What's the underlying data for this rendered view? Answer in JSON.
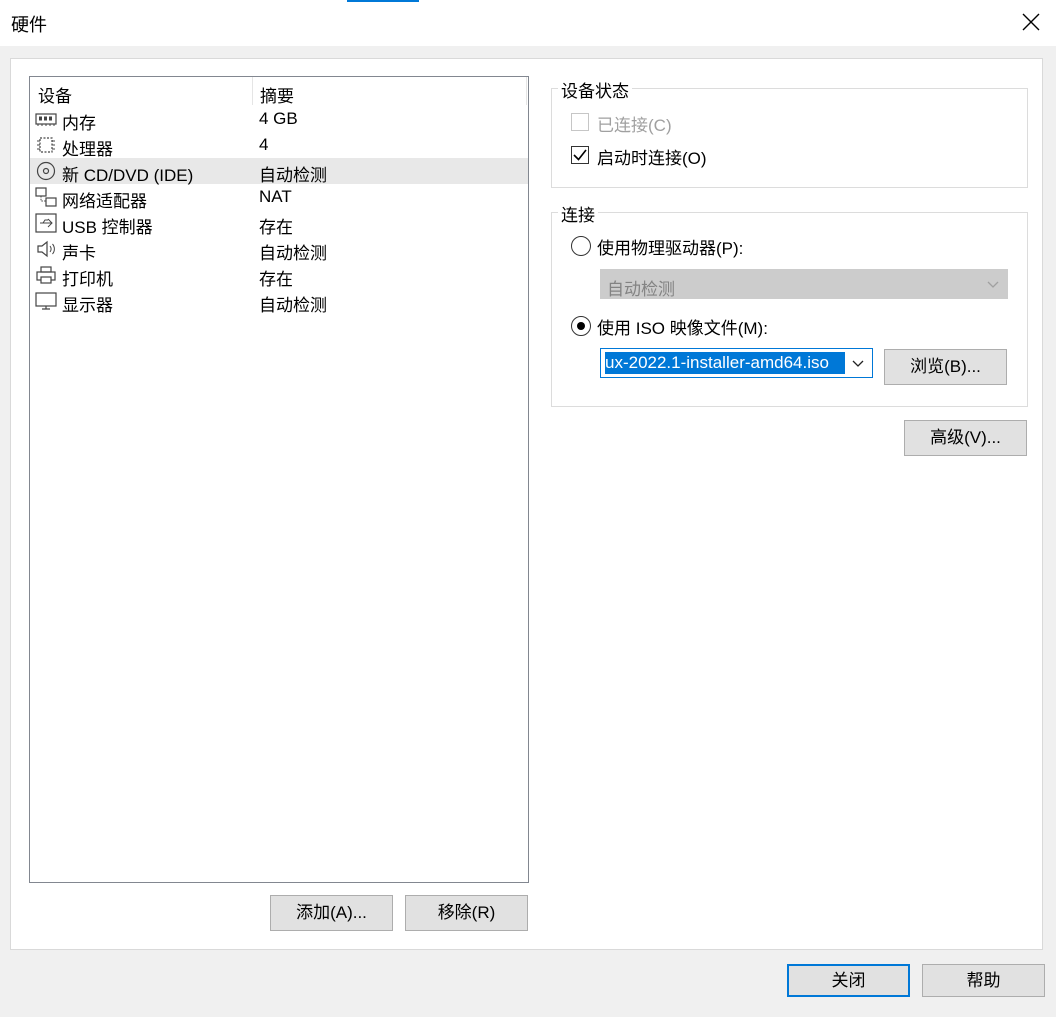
{
  "window": {
    "title": "硬件"
  },
  "device_list": {
    "columns": [
      "设备",
      "摘要"
    ],
    "rows": [
      {
        "icon": "memory-icon",
        "name": "内存",
        "summary": "4 GB",
        "selected": false
      },
      {
        "icon": "processor-icon",
        "name": "处理器",
        "summary": "4",
        "selected": false
      },
      {
        "icon": "cd-dvd-icon",
        "name": "新 CD/DVD (IDE)",
        "summary": "自动检测",
        "selected": true
      },
      {
        "icon": "network-adapter-icon",
        "name": "网络适配器",
        "summary": "NAT",
        "selected": false
      },
      {
        "icon": "usb-controller-icon",
        "name": "USB 控制器",
        "summary": "存在",
        "selected": false
      },
      {
        "icon": "sound-card-icon",
        "name": "声卡",
        "summary": "自动检测",
        "selected": false
      },
      {
        "icon": "printer-icon",
        "name": "打印机",
        "summary": "存在",
        "selected": false
      },
      {
        "icon": "display-icon",
        "name": "显示器",
        "summary": "自动检测",
        "selected": false
      }
    ],
    "add_button": "添加(A)...",
    "remove_button": "移除(R)"
  },
  "device_status": {
    "title": "设备状态",
    "connected": {
      "label": "已连接(C)",
      "checked": false,
      "disabled": true
    },
    "connect_at_power_on": {
      "label": "启动时连接(O)",
      "checked": true
    }
  },
  "connection": {
    "title": "连接",
    "physical_drive": {
      "label": "使用物理驱动器(P):",
      "selected": false,
      "value": "自动检测"
    },
    "iso_image": {
      "label": "使用 ISO 映像文件(M):",
      "selected": true,
      "value": "ux-2022.1-installer-amd64.iso"
    },
    "browse_button": "浏览(B)..."
  },
  "advanced_button": "高级(V)...",
  "footer": {
    "close_button": "关闭",
    "help_button": "帮助"
  },
  "colors": {
    "accent": "#0078d7",
    "selection": "#e8e8e8",
    "disabled_combo": "#cccccc"
  }
}
